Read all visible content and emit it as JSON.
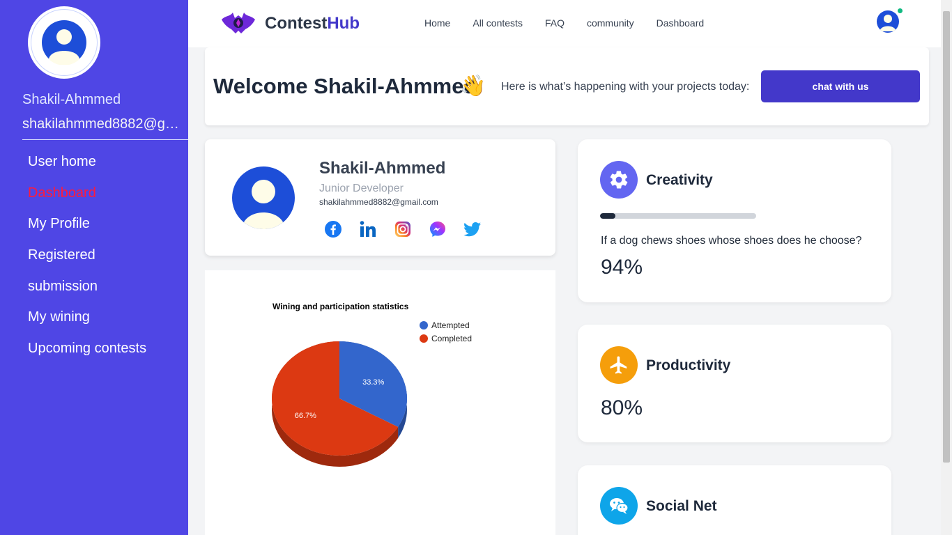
{
  "sidebar": {
    "user_name": "Shakil-Ahmmed",
    "user_email": "shakilahmmed8882@gma..",
    "items": [
      {
        "label": "User home"
      },
      {
        "label": "Dashboard"
      },
      {
        "label": "My Profile"
      },
      {
        "label": "Registered"
      },
      {
        "label": "submission"
      },
      {
        "label": "My wining"
      },
      {
        "label": "Upcoming contests"
      }
    ]
  },
  "topbar": {
    "brand_part1": "Contest",
    "brand_part2": "Hub",
    "links": [
      "Home",
      "All contests",
      "FAQ",
      "community",
      "Dashboard"
    ]
  },
  "welcome": {
    "title": "Welcome Shakil-Ahmmed",
    "wave": "👋",
    "subtitle": "Here is what’s happening with your projects today:",
    "chat_button": "chat with us"
  },
  "profile": {
    "name": "Shakil-Ahmmed",
    "role": "Junior Developer",
    "email": "shakilahmmed8882@gmail.com",
    "socials": [
      "facebook-icon",
      "linkedin-icon",
      "instagram-icon",
      "messenger-icon",
      "twitter-icon"
    ]
  },
  "chart_data": {
    "type": "pie",
    "title": "Wining and participation statistics",
    "categories": [
      "Attempted",
      "Completed"
    ],
    "values": [
      33.3,
      66.7
    ],
    "labels": [
      "33.3%",
      "66.7%"
    ],
    "colors": [
      "#3366cc",
      "#dc3912"
    ],
    "legend_position": "right",
    "is3D": true
  },
  "stats": [
    {
      "title": "Creativity",
      "icon": "gear-icon",
      "color": "#6366f1",
      "progress": 0.1,
      "question": "If a dog chews shoes whose shoes does he choose?",
      "value": "94%"
    },
    {
      "title": "Productivity",
      "icon": "airplane-icon",
      "color": "#f59e0b",
      "value": "80%"
    },
    {
      "title": "Social Net",
      "icon": "wechat-icon",
      "color": "#0ea5e9"
    }
  ]
}
